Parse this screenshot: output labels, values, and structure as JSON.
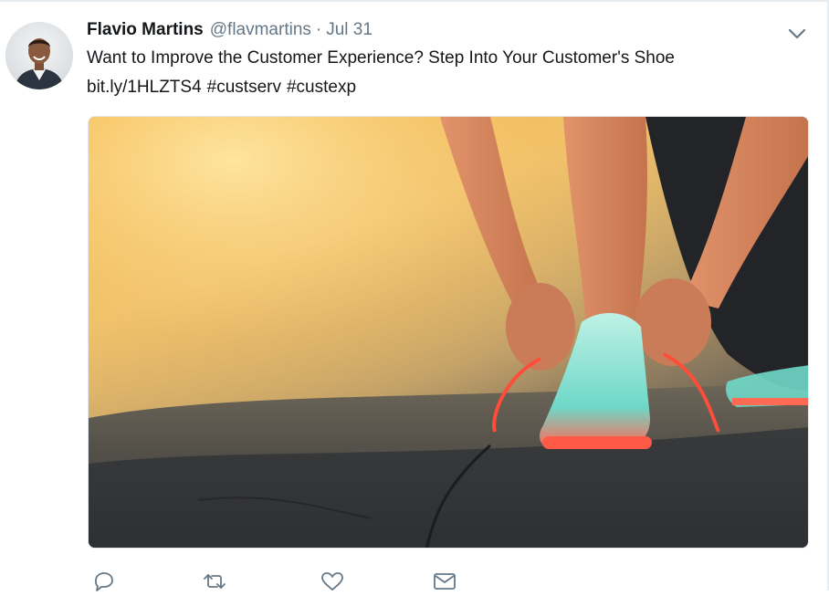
{
  "tweet": {
    "author_name": "Flavio Martins",
    "author_handle": "@flavmartins",
    "separator": "·",
    "date": "Jul 31",
    "text_line1": "Want to Improve the Customer Experience? Step Into Your Customer's Shoe",
    "link": "bit.ly/1HLZTS4",
    "hashtags": [
      "#custserv",
      "#custexp"
    ]
  },
  "icons": {
    "more": "chevron-down-icon",
    "reply": "reply-icon",
    "retweet": "retweet-icon",
    "like": "heart-icon",
    "dm": "envelope-icon"
  },
  "colors": {
    "text_primary": "#14171a",
    "text_secondary": "#657786",
    "icon_gray": "#657786",
    "border": "#e6ecf0"
  }
}
